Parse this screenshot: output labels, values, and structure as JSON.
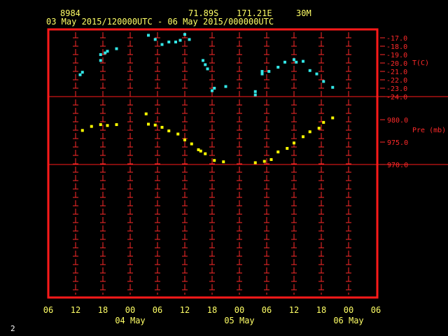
{
  "header": {
    "station": "8984",
    "latitude": "71.89S",
    "longitude": "171.21E",
    "interval": "30M",
    "period": "03 May 2015/120000UTC - 06 May 2015/000000UTC"
  },
  "footer": {
    "page_number": "2"
  },
  "colors": {
    "frame": "#ff1a1a",
    "ticks": "#ff2a2a",
    "axis_text_right": "#ff2a2a",
    "axis_text_bottom": "#ffff66",
    "temperature": "#33e6e6",
    "pressure": "#ffff00"
  },
  "chart_data": {
    "type": "scatter",
    "x_axis": {
      "tick_labels": [
        "06",
        "12",
        "18",
        "00",
        "06",
        "12",
        "18",
        "00",
        "06",
        "12",
        "18",
        "00",
        "06"
      ],
      "date_labels": [
        {
          "label": "04 May",
          "at_tick": 3
        },
        {
          "label": "05 May",
          "at_tick": 7
        },
        {
          "label": "06 May",
          "at_tick": 11
        }
      ],
      "start": "03 May 2015 06 UTC",
      "end": "06 May 2015 06 UTC"
    },
    "temperature": {
      "label": "T(C)",
      "ticks": [
        -17.0,
        -18.0,
        -19.0,
        -20.0,
        -21.0,
        -22.0,
        -23.0,
        -24.0
      ],
      "tick_labels": [
        "-17.0",
        "-18.0",
        "-19.0",
        "-20.0",
        "-21.0",
        "-22.0",
        "-23.0",
        "-24.0"
      ],
      "ylim": [
        -24.0,
        -17.0
      ],
      "points": [
        [
          "03 May 13:00",
          -21.4
        ],
        [
          "03 May 13:30",
          -21.1
        ],
        [
          "03 May 17:30",
          -19.7
        ],
        [
          "03 May 17:30",
          -19.0
        ],
        [
          "03 May 18:30",
          -18.8
        ],
        [
          "03 May 19:00",
          -18.6
        ],
        [
          "03 May 21:00",
          -18.3
        ],
        [
          "04 May 04:00",
          -16.7
        ],
        [
          "04 May 05:30",
          -17.2
        ],
        [
          "04 May 07:00",
          -17.8
        ],
        [
          "04 May 08:30",
          -17.5
        ],
        [
          "04 May 10:00",
          -17.5
        ],
        [
          "04 May 11:00",
          -17.3
        ],
        [
          "04 May 12:00",
          -16.6
        ],
        [
          "04 May 13:00",
          -17.2
        ],
        [
          "04 May 16:00",
          -19.7
        ],
        [
          "04 May 16:30",
          -20.2
        ],
        [
          "04 May 17:00",
          -20.7
        ],
        [
          "04 May 18:00",
          -23.3
        ],
        [
          "04 May 18:30",
          -23.0
        ],
        [
          "04 May 21:00",
          -22.8
        ],
        [
          "05 May 03:30",
          -23.8
        ],
        [
          "05 May 03:30",
          -23.4
        ],
        [
          "05 May 05:00",
          -21.0
        ],
        [
          "05 May 05:00",
          -21.3
        ],
        [
          "05 May 06:30",
          -21.0
        ],
        [
          "05 May 08:30",
          -20.5
        ],
        [
          "05 May 10:00",
          -19.9
        ],
        [
          "05 May 12:00",
          -19.6
        ],
        [
          "05 May 12:30",
          -19.9
        ],
        [
          "05 May 14:00",
          -19.8
        ],
        [
          "05 May 15:30",
          -20.9
        ],
        [
          "05 May 17:00",
          -21.3
        ],
        [
          "05 May 18:30",
          -22.2
        ],
        [
          "05 May 20:30",
          -22.9
        ]
      ]
    },
    "pressure": {
      "label": "Pre (mb)",
      "ticks": [
        980.0,
        975.0,
        970.0
      ],
      "tick_labels": [
        "980.0",
        "975.0",
        "970.0"
      ],
      "ylim": [
        970.0,
        980.0
      ],
      "points": [
        [
          "03 May 13:30",
          977.6
        ],
        [
          "03 May 15:30",
          978.5
        ],
        [
          "03 May 17:30",
          978.9
        ],
        [
          "03 May 19:00",
          978.7
        ],
        [
          "03 May 21:00",
          978.9
        ],
        [
          "04 May 03:30",
          981.3
        ],
        [
          "04 May 04:00",
          979.0
        ],
        [
          "04 May 05:30",
          978.8
        ],
        [
          "04 May 07:00",
          978.3
        ],
        [
          "04 May 08:30",
          977.5
        ],
        [
          "04 May 10:30",
          976.8
        ],
        [
          "04 May 12:00",
          975.5
        ],
        [
          "04 May 13:30",
          974.6
        ],
        [
          "04 May 15:00",
          973.3
        ],
        [
          "04 May 15:30",
          973.0
        ],
        [
          "04 May 16:30",
          972.4
        ],
        [
          "04 May 18:30",
          970.9
        ],
        [
          "04 May 20:30",
          970.6
        ],
        [
          "05 May 03:30",
          970.4
        ],
        [
          "05 May 05:30",
          970.7
        ],
        [
          "05 May 07:00",
          971.1
        ],
        [
          "05 May 08:30",
          972.8
        ],
        [
          "05 May 10:30",
          973.6
        ],
        [
          "05 May 12:00",
          974.8
        ],
        [
          "05 May 14:00",
          976.2
        ],
        [
          "05 May 15:30",
          977.3
        ],
        [
          "05 May 17:30",
          978.1
        ],
        [
          "05 May 18:30",
          979.4
        ],
        [
          "05 May 20:30",
          980.4
        ]
      ]
    },
    "grid": true,
    "reference_lines": [
      "temperature -24.0",
      "pressure 970.0"
    ]
  }
}
